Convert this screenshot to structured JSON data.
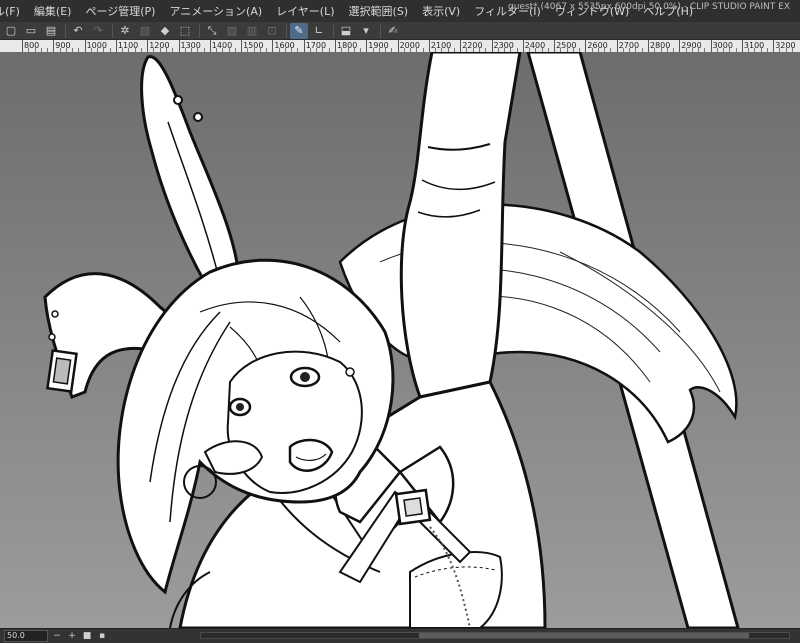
{
  "menubar": {
    "items": [
      "ル(F)",
      "編集(E)",
      "ページ管理(P)",
      "アニメーション(A)",
      "レイヤー(L)",
      "選択範囲(S)",
      "表示(V)",
      "フィルター(I)",
      "ウィンドウ(W)",
      "ヘルプ(H)"
    ],
    "title": "guest* (4067 x 5535px 600dpi 50.0%)  - CLIP STUDIO PAINT EX"
  },
  "commandbar": {
    "buttons": [
      {
        "icon": "new-file-icon",
        "glyph": "▢"
      },
      {
        "icon": "open-file-icon",
        "glyph": "▭"
      },
      {
        "icon": "save-icon",
        "glyph": "▤"
      },
      {
        "icon": "undo-icon",
        "glyph": "↶"
      },
      {
        "icon": "redo-icon",
        "glyph": "↷"
      },
      {
        "icon": "settings-icon",
        "glyph": "✲"
      },
      {
        "icon": "clear-icon",
        "glyph": "▧"
      },
      {
        "icon": "fill-icon",
        "glyph": "◆"
      },
      {
        "icon": "transform-icon",
        "glyph": "⬚"
      },
      {
        "icon": "select-tool-icon",
        "glyph": "⤡"
      },
      {
        "icon": "snap-ruler-icon",
        "glyph": "▨"
      },
      {
        "icon": "snap-grid-icon",
        "glyph": "▥"
      },
      {
        "icon": "snap-special-icon",
        "glyph": "⊡"
      },
      {
        "icon": "pen-tool-icon",
        "glyph": "✎"
      },
      {
        "icon": "ruler-tool-icon",
        "glyph": "∟"
      },
      {
        "icon": "view-mode-icon",
        "glyph": "⬓"
      },
      {
        "icon": "dropdown-icon",
        "glyph": "▾"
      },
      {
        "icon": "note-icon",
        "glyph": "✍"
      }
    ]
  },
  "ruler": {
    "labels": [
      "800",
      "900",
      "1000",
      "1100",
      "1200",
      "1300",
      "1400",
      "1500",
      "1600",
      "1700",
      "1800",
      "1900",
      "2000",
      "2100",
      "2200",
      "2300",
      "2400",
      "2500",
      "2600",
      "2700",
      "2800",
      "2900",
      "3000",
      "3100",
      "3200"
    ]
  },
  "statusbar": {
    "zoom": "50.0",
    "controls": [
      "−",
      "+",
      "■",
      "▪"
    ]
  }
}
